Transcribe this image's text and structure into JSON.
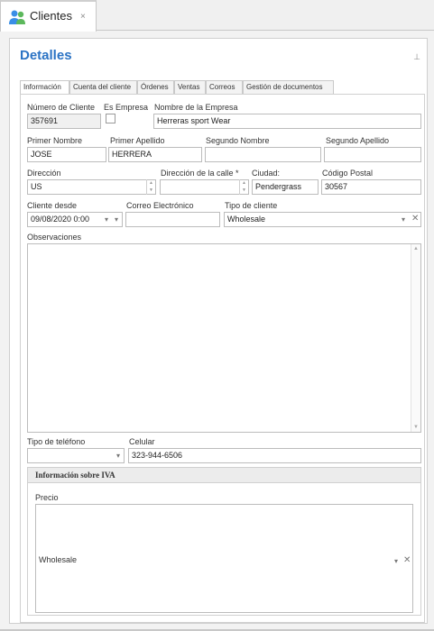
{
  "window": {
    "tab_title": "Clientes",
    "tab_close": "×"
  },
  "panel": {
    "title": "Detalles",
    "pin_glyph": "⊥"
  },
  "tabs": [
    "Información",
    "Cuenta del cliente",
    "Órdenes",
    "Ventas",
    "Correos",
    "Gestión de documentos"
  ],
  "form": {
    "numero_cliente": {
      "label": "Número de Cliente",
      "value": "357691"
    },
    "es_empresa": {
      "label": "Es Empresa",
      "checked": false
    },
    "nombre_empresa": {
      "label": "Nombre de la Empresa",
      "value": "Herreras sport Wear"
    },
    "primer_nombre": {
      "label": "Primer Nombre",
      "value": "JOSE"
    },
    "primer_apellido": {
      "label": "Primer Apellido",
      "value": "HERRERA"
    },
    "segundo_nombre": {
      "label": "Segundo Nombre",
      "value": ""
    },
    "segundo_apellido": {
      "label": "Segundo Apellido",
      "value": ""
    },
    "direccion": {
      "label": "Dirección",
      "value": "US"
    },
    "direccion_calle": {
      "label": "Dirección de la calle *",
      "value": ""
    },
    "ciudad": {
      "label": "Ciudad:",
      "value": "Pendergrass"
    },
    "codigo_postal": {
      "label": "Código Postal",
      "value": "30567"
    },
    "cliente_desde": {
      "label": "Cliente desde",
      "value": "09/08/2020 0:00"
    },
    "correo": {
      "label": "Correo Electrónico",
      "value": ""
    },
    "tipo_cliente": {
      "label": "Tipo de cliente",
      "value": "Wholesale"
    },
    "observaciones": {
      "label": "Observaciones",
      "value": ""
    },
    "tipo_telefono": {
      "label": "Tipo de teléfono",
      "value": ""
    },
    "celular": {
      "label": "Celular",
      "value": "323-944-6506"
    }
  },
  "iva": {
    "header": "Información sobre IVA",
    "precio_label": "Precio",
    "precio_value": "Wholesale"
  },
  "icons": {
    "dropdown": "▾",
    "clear": "✕",
    "spin_up": "▲",
    "spin_down": "▼",
    "scroll_up": "▲",
    "scroll_down": "▼"
  },
  "colors": {
    "accent": "#2b73c4",
    "icon_green": "#5cb85c",
    "icon_blue": "#3a8ee6"
  }
}
